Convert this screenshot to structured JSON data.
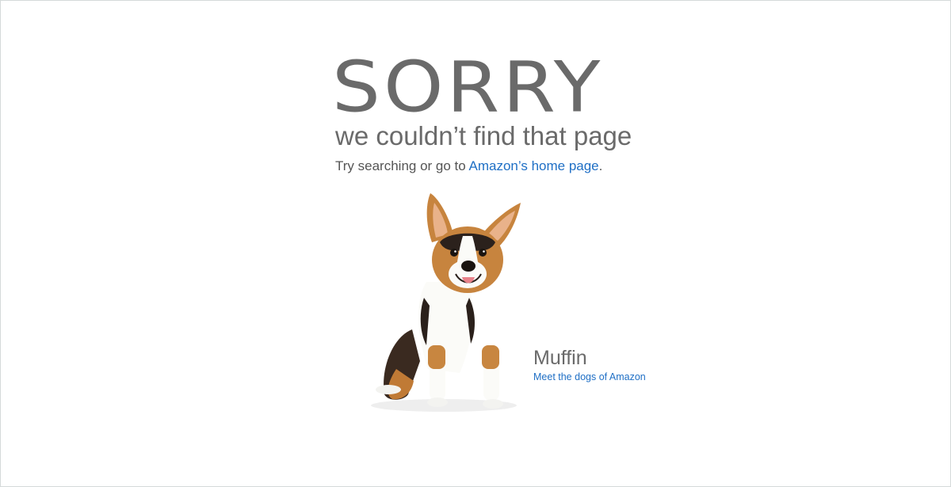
{
  "error": {
    "headline": "SORRY",
    "subheadline": "we couldn’t find that page",
    "prompt_text": "Try searching or go to ",
    "home_link": "Amazon’s home page",
    "prompt_end": "."
  },
  "dog": {
    "image": "corgi-dog-photo",
    "name": "Muffin",
    "link": "Meet the dogs of Amazon"
  },
  "colors": {
    "text_gray": "#6a6a6a",
    "link_blue": "#1f6fc5",
    "background": "#ffffff"
  }
}
